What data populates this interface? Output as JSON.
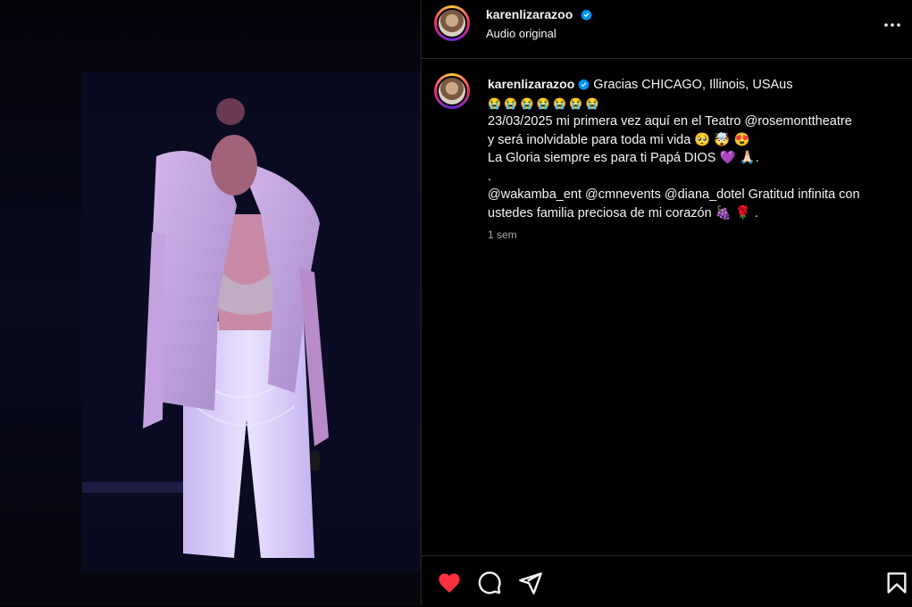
{
  "post": {
    "username": "karenlizarazoo",
    "audio_label": "Audio original",
    "more_icon": "more-icon",
    "comment": {
      "username": "karenlizarazoo",
      "line1": "Gracias CHICAGO, Illinois, USAus",
      "line2_emojis": "😭 😭 😭 😭 😭 😭 😭",
      "line3": "23/03/2025 mi primera vez aquí en el Teatro @rosemonttheatre",
      "line4": "y será inolvidable para toda mi vida 🥺 🤯 😍",
      "line5": "La Gloria siempre es para ti Papá DIOS 💜 🙏🏻.",
      "line6": ".",
      "line7": "@wakamba_ent @cmnevents @diana_dotel Gratitud infinita con",
      "line8": "ustedes familia preciosa de mi corazón 🍇 🌹 .",
      "time": "1 sem"
    }
  },
  "actions": {
    "like_icon": "heart-icon",
    "comment_icon": "comment-icon",
    "share_icon": "share-icon",
    "save_icon": "bookmark-icon",
    "like_color": "#ff3040"
  },
  "colors": {
    "verified": "#0095f6",
    "divider": "#262626",
    "muted": "#a8a8a8"
  }
}
